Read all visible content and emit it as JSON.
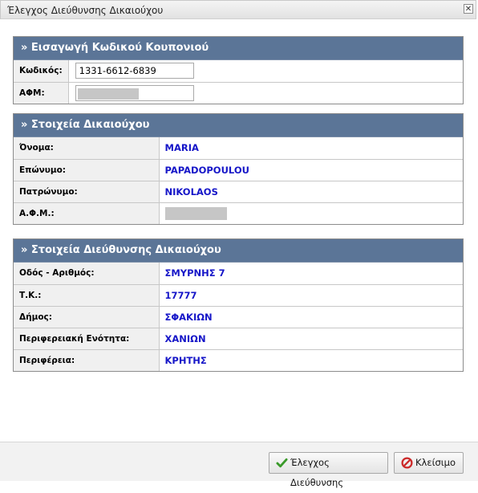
{
  "window": {
    "title": "Έλεγχος Διεύθυνσης Δικαιούχου",
    "close_glyph": "✕"
  },
  "coupon": {
    "header": "» Εισαγωγή Κωδικού Κουπονιού",
    "code_label": "Κωδικός:",
    "code_value": "1331-6612-6839",
    "afm_label": "ΑΦΜ:"
  },
  "beneficiary": {
    "header": "» Στοιχεία Δικαιούχου",
    "rows": [
      {
        "label": "Όνομα:",
        "value": "MARIA"
      },
      {
        "label": "Επώνυμο:",
        "value": "PAPADOPOULOU"
      },
      {
        "label": "Πατρώνυμο:",
        "value": "NIKOLAOS"
      },
      {
        "label": "Α.Φ.Μ.:",
        "value": ""
      }
    ]
  },
  "address": {
    "header": "» Στοιχεία Διεύθυνσης Δικαιούχου",
    "rows": [
      {
        "label": "Οδός - Αριθμός:",
        "value": "ΣΜΥΡΝΗΣ 7"
      },
      {
        "label": "Τ.Κ.:",
        "value": "17777"
      },
      {
        "label": "Δήμος:",
        "value": "ΣΦΑΚΙΩΝ"
      },
      {
        "label": "Περιφερειακή Ενότητα:",
        "value": "ΧΑΝΙΩΝ"
      },
      {
        "label": "Περιφέρεια:",
        "value": "ΚΡΗΤΗΣ"
      }
    ]
  },
  "footer": {
    "check_button": "Έλεγχος Διεύθυνσης",
    "close_button": "Κλείσιμο"
  },
  "colors": {
    "header_bg": "#5b7597",
    "value_text": "#1616c8",
    "check_icon": "#3a9a2a",
    "close_icon": "#cc2a2a"
  }
}
